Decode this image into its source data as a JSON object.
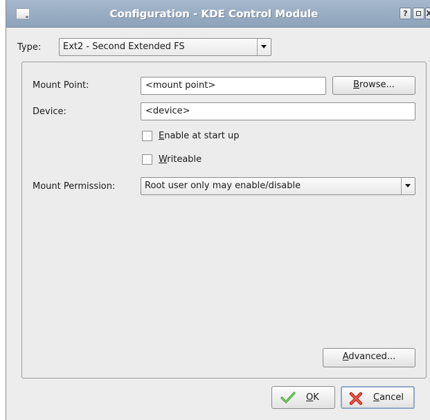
{
  "window": {
    "title": "Configuration - KDE Control Module",
    "help_glyph": "?",
    "close_glyph": "X"
  },
  "type_row": {
    "label": "Type:",
    "selected": "Ext2 - Second Extended FS"
  },
  "mount_point": {
    "label": "Mount Point:",
    "value": "<mount point>",
    "browse_mnemonic": "B",
    "browse_rest": "rowse..."
  },
  "device": {
    "label": "Device:",
    "value": "<device>"
  },
  "options": {
    "enable_mnemonic": "E",
    "enable_rest": "nable at start up",
    "enable_checked": false,
    "writeable_mnemonic": "W",
    "writeable_rest": "riteable",
    "writeable_checked": false
  },
  "permission": {
    "label": "Mount Permission:",
    "selected": "Root user only may enable/disable"
  },
  "advanced": {
    "mnemonic": "A",
    "rest": "dvanced..."
  },
  "footer": {
    "ok_mnemonic": "O",
    "ok_rest": "K",
    "cancel_mnemonic": "C",
    "cancel_rest": "ancel"
  },
  "icons": {
    "ok": "checkmark-icon",
    "cancel": "red-x-icon",
    "title": "document-icon"
  }
}
